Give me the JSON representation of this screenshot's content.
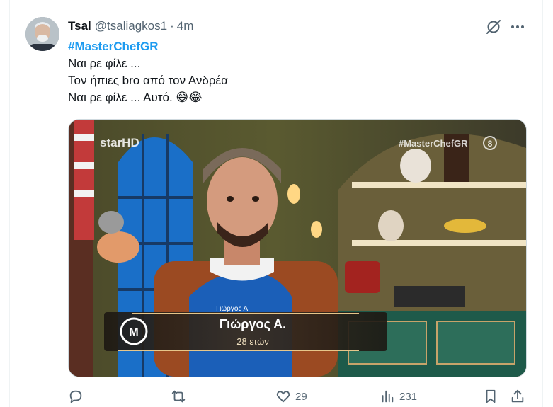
{
  "tweet": {
    "display_name": "Tsal",
    "handle": "@tsaliagkos1",
    "separator": "·",
    "time": "4m",
    "hashtag": "#MasterChefGR",
    "lines": [
      "Ναι ρε φίλε ...",
      "Τον ήπιες bro από τον Ανδρέα",
      "Ναι ρε φίλε ... Αυτό. 😅😂"
    ]
  },
  "media": {
    "channel_logo": "starHD",
    "show_tag": "#MasterChefGR",
    "rating_badge": "8",
    "apron_name": "Γιώργος Α.",
    "lower_third_name": "Γιώργος Α.",
    "lower_third_age": "28 ετών"
  },
  "actions": {
    "reply_count": "",
    "retweet_count": "",
    "like_count": "29",
    "views_count": "231"
  },
  "icons": {
    "grok": "grok-icon",
    "more": "more-icon",
    "reply": "reply-icon",
    "retweet": "retweet-icon",
    "like": "heart-icon",
    "views": "views-icon",
    "bookmark": "bookmark-icon",
    "share": "share-icon"
  },
  "colors": {
    "accent": "#1d9bf0",
    "muted": "#536471",
    "text": "#0f1419"
  }
}
